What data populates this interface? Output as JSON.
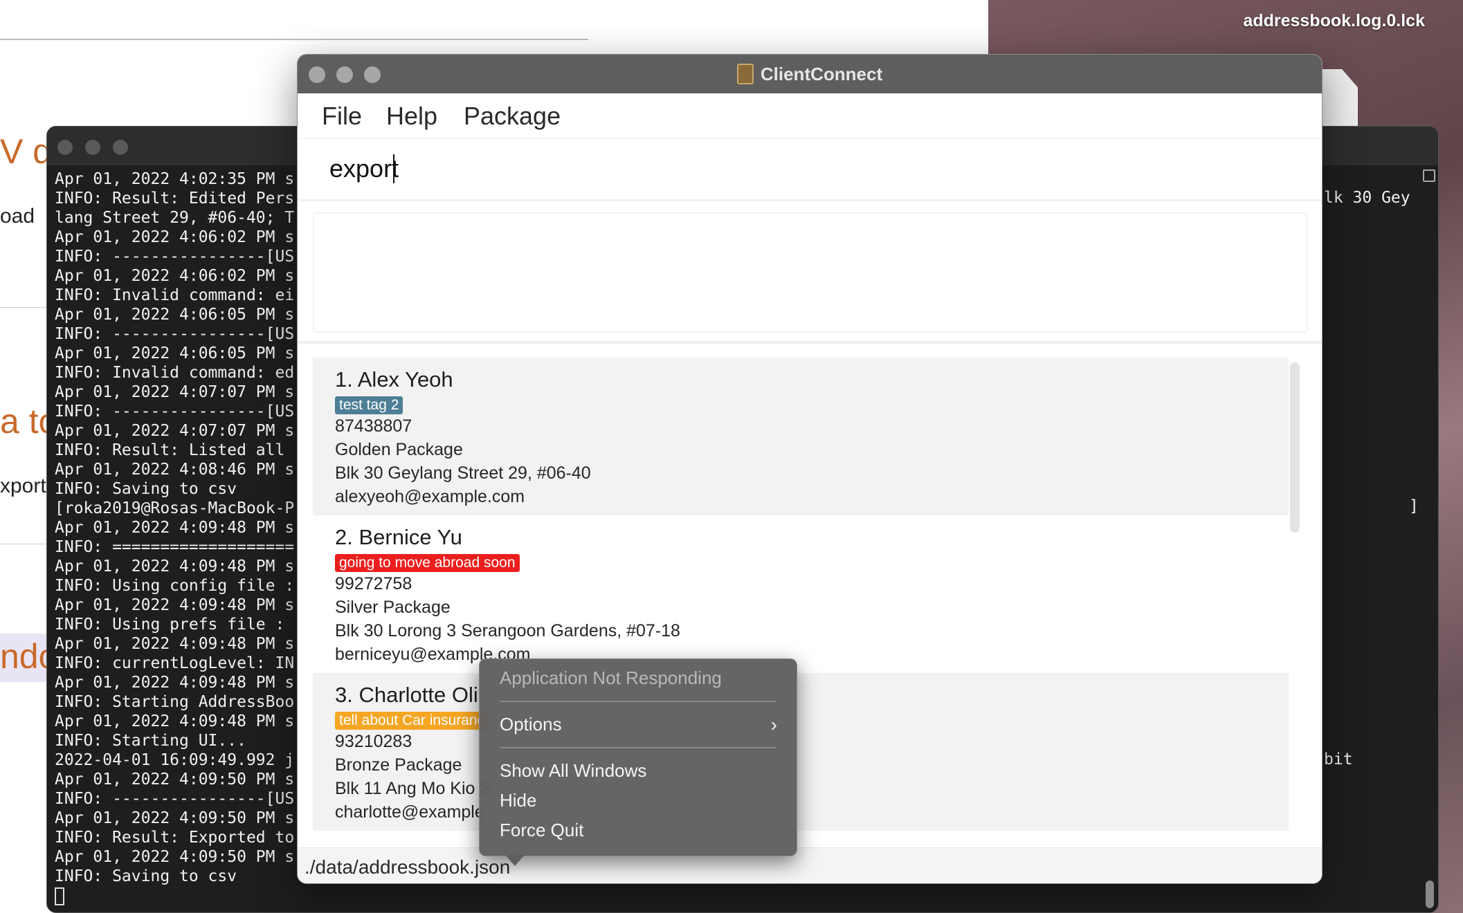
{
  "desktop": {
    "file_label": "addressbook.log.0.lck"
  },
  "doc_fragments": {
    "frag1": "V d",
    "frag2": "oad",
    "frag3": "a to",
    "frag4": "xport",
    "frag5": "ndo"
  },
  "terminal": {
    "lines": [
      "Apr 01, 2022 4:02:35 PM s",
      "INFO: Result: Edited Pers",
      "lang Street 29, #06-40; T",
      "Apr 01, 2022 4:06:02 PM s",
      "INFO: ----------------[US",
      "Apr 01, 2022 4:06:02 PM s",
      "INFO: Invalid command: ei",
      "Apr 01, 2022 4:06:05 PM s",
      "INFO: ----------------[US",
      "Apr 01, 2022 4:06:05 PM s",
      "INFO: Invalid command: ed",
      "Apr 01, 2022 4:07:07 PM s",
      "INFO: ----------------[US",
      "Apr 01, 2022 4:07:07 PM s",
      "INFO: Result: Listed all",
      "Apr 01, 2022 4:08:46 PM s",
      "INFO: Saving to csv",
      "[roka2019@Rosas-MacBook-Pr",
      "Apr 01, 2022 4:09:48 PM s",
      "INFO: ===================",
      "Apr 01, 2022 4:09:48 PM s",
      "INFO: Using config file :",
      "Apr 01, 2022 4:09:48 PM s",
      "INFO: Using prefs file :",
      "Apr 01, 2022 4:09:48 PM s",
      "INFO: currentLogLevel: IN",
      "Apr 01, 2022 4:09:48 PM s",
      "INFO: Starting AddressBoo",
      "Apr 01, 2022 4:09:48 PM s",
      "INFO: Starting UI...",
      "2022-04-01 16:09:49.992 j",
      "Apr 01, 2022 4:09:50 PM s",
      "INFO: ----------------[US",
      "Apr 01, 2022 4:09:50 PM s",
      "INFO: Result: Exported to",
      "Apr 01, 2022 4:09:50 PM s",
      "INFO: Saving to csv"
    ],
    "right_fragment_1": "lk 30 Gey",
    "right_fragment_2": "]",
    "right_fragment_3": "bit"
  },
  "app": {
    "title": "ClientConnect",
    "menu": {
      "file": "File",
      "help": "Help",
      "package": "Package"
    },
    "command_value": "export",
    "status_path": "./data/addressbook.json",
    "persons": [
      {
        "name": "1.  Alex Yeoh",
        "tag": "test tag 2",
        "tag_color": "#4d7f96",
        "phone": "87438807",
        "package": "Golden Package",
        "address": "Blk 30 Geylang Street 29, #06-40",
        "email": "alexyeoh@example.com"
      },
      {
        "name": "2.  Bernice Yu",
        "tag": "going to move abroad soon",
        "tag_color": "#ec1e1e",
        "phone": "99272758",
        "package": "Silver Package",
        "address": "Blk 30 Lorong 3 Serangoon Gardens, #07-18",
        "email": "berniceyu@example.com"
      },
      {
        "name": "3.  Charlotte Oli",
        "tag": "tell about Car insuranc",
        "tag_color": "#f5a623",
        "phone": "93210283",
        "package": "Bronze Package",
        "address": "Blk 11 Ang Mo Kio S",
        "email": "charlotte@example"
      }
    ]
  },
  "context_menu": {
    "header": "Application Not Responding",
    "options": "Options",
    "show_all_windows": "Show All Windows",
    "hide": "Hide",
    "force_quit": "Force Quit"
  }
}
